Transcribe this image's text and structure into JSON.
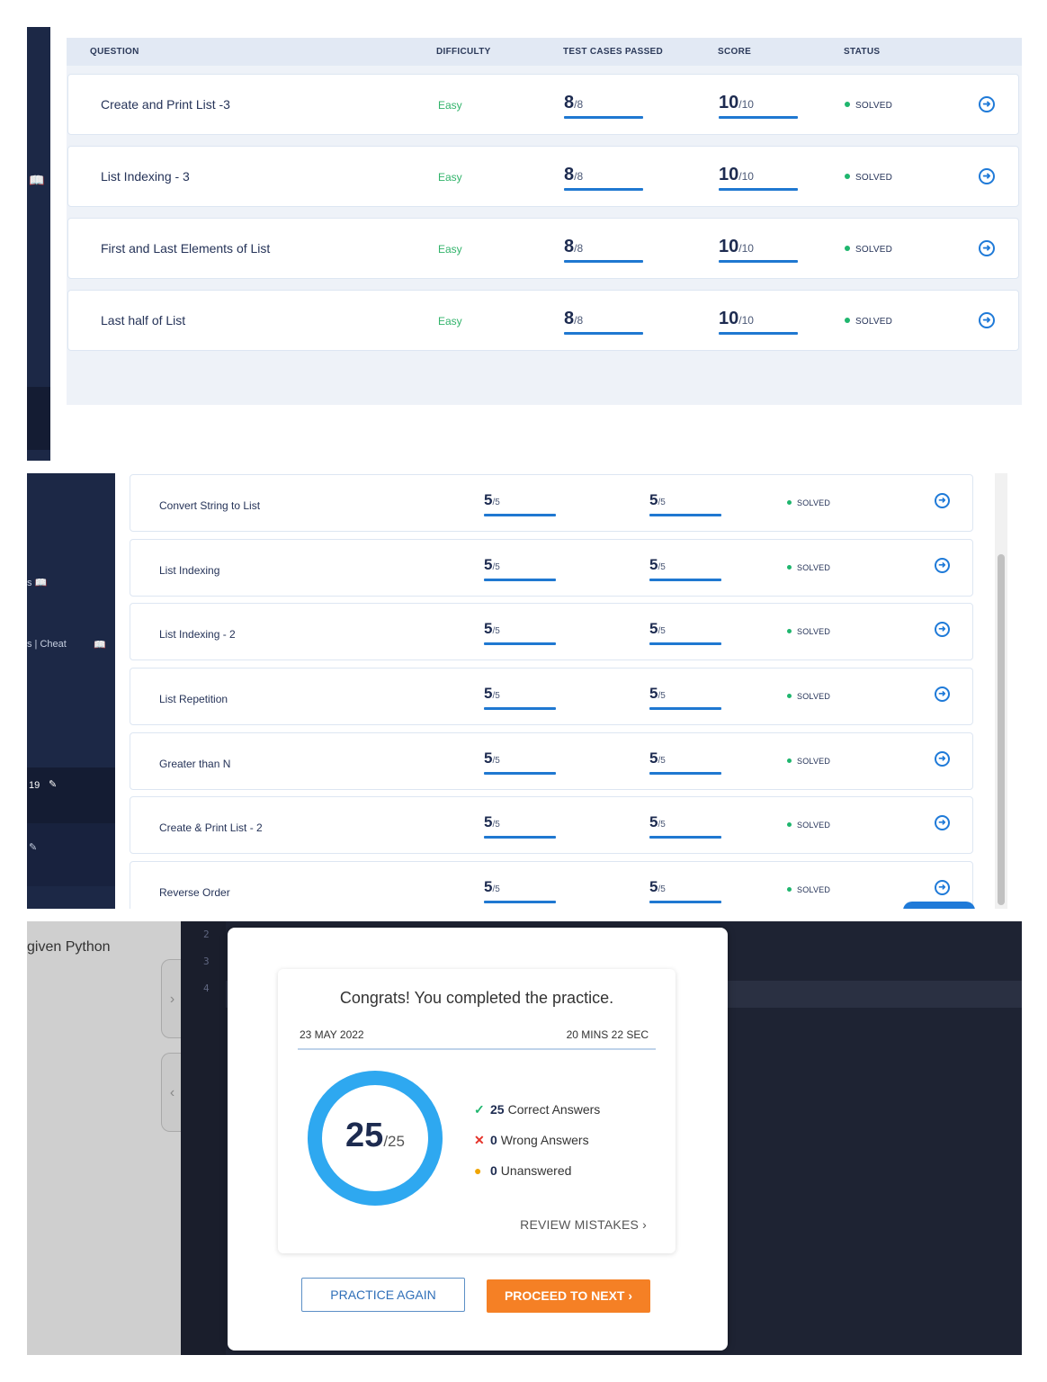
{
  "panel1": {
    "headers": {
      "question": "QUESTION",
      "difficulty": "DIFFICULTY",
      "tests": "TEST CASES PASSED",
      "score": "SCORE",
      "status": "STATUS"
    },
    "rows": [
      {
        "question": "Create and Print List -3",
        "difficulty": "Easy",
        "tests": "8",
        "tests_total": "/8",
        "score": "10",
        "score_total": "/10",
        "status": "SOLVED"
      },
      {
        "question": "List Indexing - 3",
        "difficulty": "Easy",
        "tests": "8",
        "tests_total": "/8",
        "score": "10",
        "score_total": "/10",
        "status": "SOLVED"
      },
      {
        "question": "First and Last Elements of List",
        "difficulty": "Easy",
        "tests": "8",
        "tests_total": "/8",
        "score": "10",
        "score_total": "/10",
        "status": "SOLVED"
      },
      {
        "question": "Last half of List",
        "difficulty": "Easy",
        "tests": "8",
        "tests_total": "/8",
        "score": "10",
        "score_total": "/10",
        "status": "SOLVED"
      }
    ],
    "sidebar_icon": "book-icon"
  },
  "panel2": {
    "sidebar": {
      "cheat_label": "s | Cheat",
      "counter": "19"
    },
    "rows": [
      {
        "question": "Convert String to List",
        "tests": "5",
        "tests_total": "/5",
        "score": "5",
        "score_total": "/5",
        "status": "SOLVED"
      },
      {
        "question": "List Indexing",
        "tests": "5",
        "tests_total": "/5",
        "score": "5",
        "score_total": "/5",
        "status": "SOLVED"
      },
      {
        "question": "List Indexing - 2",
        "tests": "5",
        "tests_total": "/5",
        "score": "5",
        "score_total": "/5",
        "status": "SOLVED"
      },
      {
        "question": "List Repetition",
        "tests": "5",
        "tests_total": "/5",
        "score": "5",
        "score_total": "/5",
        "status": "SOLVED"
      },
      {
        "question": "Greater than N",
        "tests": "5",
        "tests_total": "/5",
        "score": "5",
        "score_total": "/5",
        "status": "SOLVED"
      },
      {
        "question": "Create & Print List - 2",
        "tests": "5",
        "tests_total": "/5",
        "score": "5",
        "score_total": "/5",
        "status": "SOLVED"
      },
      {
        "question": "Reverse Order",
        "tests": "5",
        "tests_total": "/5",
        "score": "5",
        "score_total": "/5",
        "status": "SOLVED"
      }
    ]
  },
  "panel3": {
    "left_text": "given Python",
    "line_numbers": [
      "2",
      "3",
      "4"
    ],
    "modal": {
      "title": "Congrats! You completed the practice.",
      "date": "23 MAY 2022",
      "duration": "20 MINS 22 SEC",
      "score": "25",
      "total": "/25",
      "score_fraction": 1.0,
      "correct_count": "25",
      "correct_label": "Correct Answers",
      "wrong_count": "0",
      "wrong_label": "Wrong Answers",
      "unanswered_count": "0",
      "unanswered_label": "Unanswered",
      "review_label": "REVIEW MISTAKES",
      "practice_again_label": "PRACTICE AGAIN",
      "proceed_label": "PROCEED TO NEXT"
    }
  },
  "colors": {
    "accent": "#1f7ad8",
    "donut": "#2ea8f0",
    "solved": "#1fb66e",
    "easy": "#31b36a",
    "orange": "#f58025",
    "sidebar": "#1c2846"
  }
}
